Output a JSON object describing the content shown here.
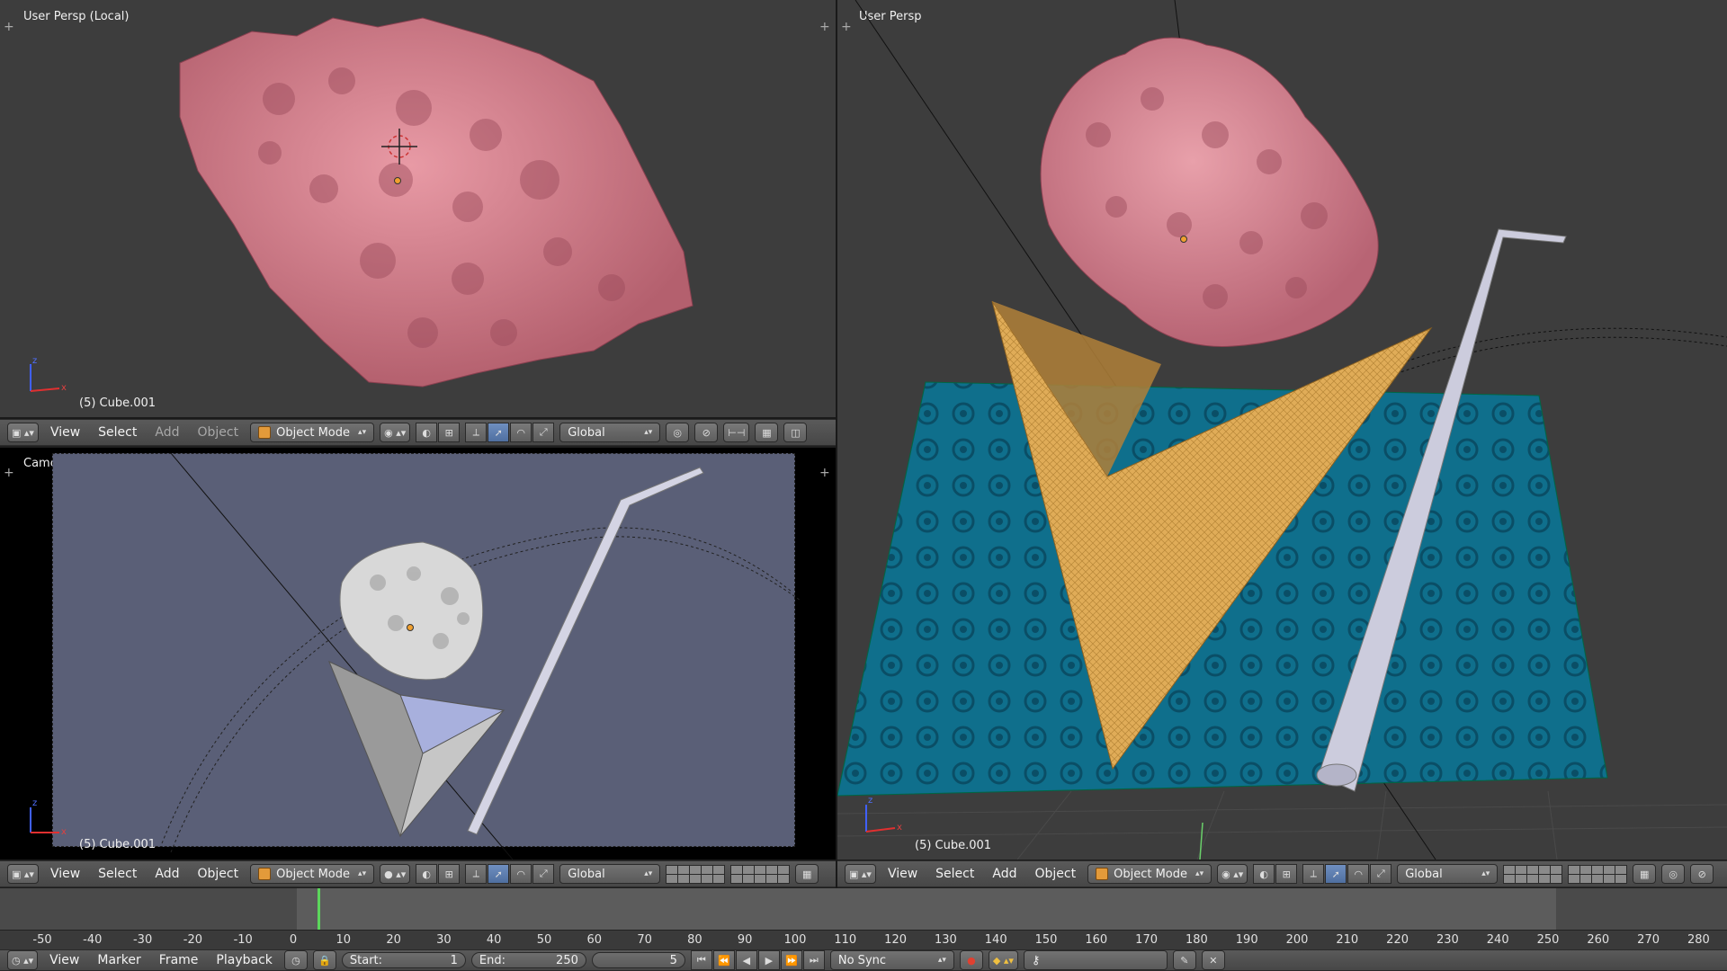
{
  "viewports": {
    "top_left": {
      "title": "User Persp (Local)",
      "object_label": "(5) Cube.001"
    },
    "bottom_left": {
      "title": "Camera Persp",
      "object_label": "(5) Cube.001"
    },
    "right": {
      "title": "User Persp",
      "object_label": "(5) Cube.001"
    }
  },
  "header": {
    "menus": [
      "View",
      "Select",
      "Add",
      "Object"
    ],
    "mode": "Object Mode",
    "orientation": "Global"
  },
  "timeline": {
    "ruler_ticks": [
      "-50",
      "-40",
      "-30",
      "-20",
      "-10",
      "0",
      "10",
      "20",
      "30",
      "40",
      "50",
      "60",
      "70",
      "80",
      "90",
      "100",
      "110",
      "120",
      "130",
      "140",
      "150",
      "160",
      "170",
      "180",
      "190",
      "200",
      "210",
      "220",
      "230",
      "240",
      "250",
      "260",
      "270",
      "280"
    ],
    "current_frame": 5,
    "menus": [
      "View",
      "Marker",
      "Frame",
      "Playback"
    ],
    "start_label": "Start:",
    "start_value": "1",
    "end_label": "End:",
    "end_value": "250",
    "frame_value": "5",
    "sync": "No Sync"
  },
  "colors": {
    "viewport_bg": "#3d3d3d",
    "camera_frame_bg": "#5a5f77",
    "rock_pink": "#d9798a",
    "plane_teal": "#0f6f8c",
    "wedge_yellow": "#e0ac58",
    "playhead": "#5cd65c"
  }
}
